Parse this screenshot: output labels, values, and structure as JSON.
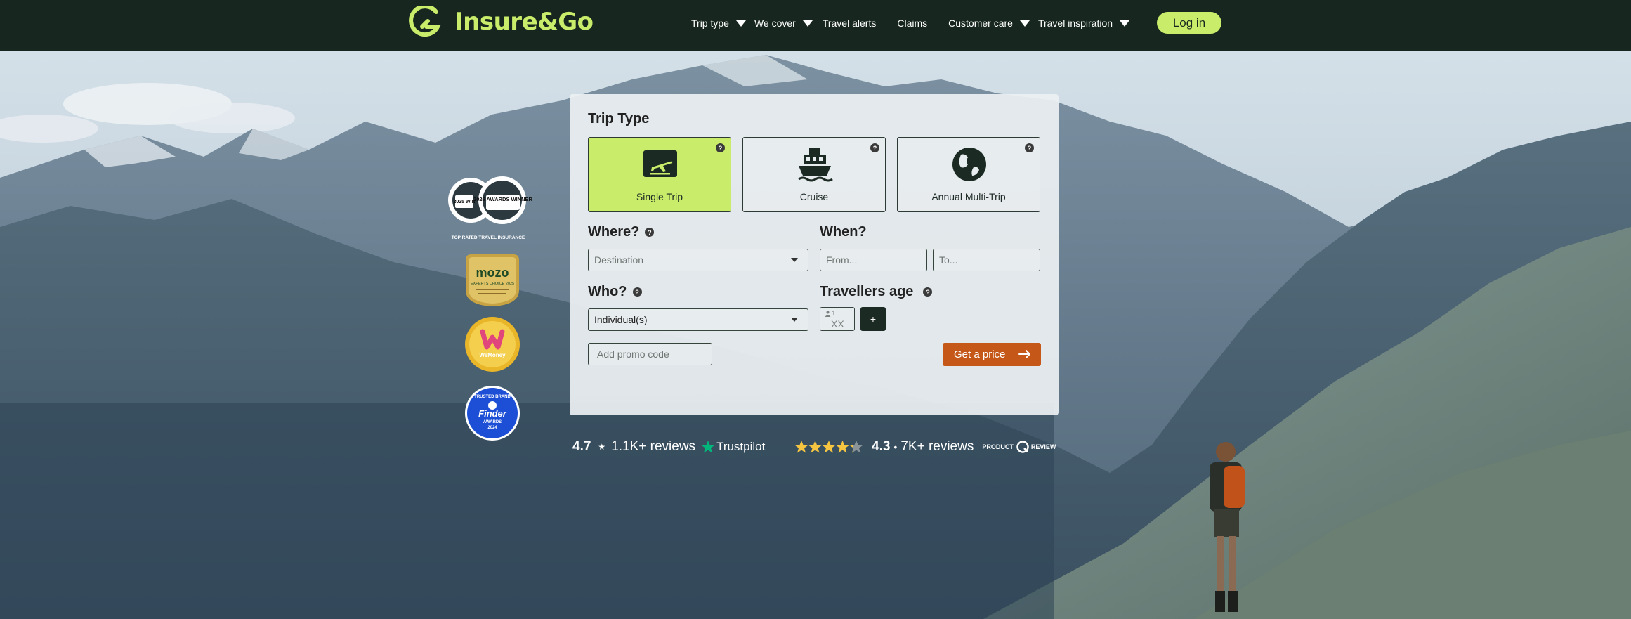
{
  "brand": {
    "name": "Insure&Go",
    "accent": "#c9ec6a",
    "header_bg": "#17271f"
  },
  "nav": {
    "items": [
      {
        "label": "Trip type",
        "dropdown": true
      },
      {
        "label": "We cover",
        "dropdown": true
      },
      {
        "label": "Travel alerts",
        "dropdown": false
      },
      {
        "label": "Claims",
        "dropdown": false
      },
      {
        "label": "Customer care",
        "dropdown": true
      },
      {
        "label": "Travel inspiration",
        "dropdown": true
      }
    ],
    "login_label": "Log in"
  },
  "badges": {
    "award_top_text": "TOP RATED TRAVEL INSURANCE",
    "award_left": "2025 WIN",
    "award_right": "2026 AWARDS WINNER",
    "mozo_name": "mozo",
    "mozo_sub": "EXPERTS CHOICE 2025",
    "wemoney_name": "WeMoney",
    "finder_top": "TRUSTED BRAND",
    "finder_name": "Finder",
    "finder_sub": "AWARDS",
    "finder_year": "2024"
  },
  "form": {
    "trip_type_title": "Trip Type",
    "help_glyph": "?",
    "trip_types": [
      {
        "label": "Single Trip",
        "icon": "plane-ticket-icon",
        "selected": true
      },
      {
        "label": "Cruise",
        "icon": "ship-icon",
        "selected": false
      },
      {
        "label": "Annual Multi-Trip",
        "icon": "globe-icon",
        "selected": false
      }
    ],
    "where_title": "Where?",
    "destination_placeholder": "Destination",
    "when_title": "When?",
    "from_placeholder": "From...",
    "to_placeholder": "To...",
    "who_title": "Who?",
    "who_value": "Individual(s)",
    "ages_title": "Travellers age",
    "traveller_number": "1",
    "age_placeholder": "XX",
    "add_traveller_label": "+",
    "promo_placeholder": "Add promo code",
    "get_price_label": "Get a price",
    "get_price_color": "#c55718"
  },
  "reviews": {
    "trustpilot_score": "4.7",
    "trustpilot_star": "★",
    "trustpilot_count": "1.1K+ reviews",
    "trustpilot_brand": "Trustpilot",
    "productreview_score": "4.3",
    "productreview_sep": "•",
    "productreview_count": "7K+ reviews",
    "productreview_brand": "PRODUCT",
    "productreview_brand2": "REVIEW",
    "productreview_rating": 4.3
  }
}
